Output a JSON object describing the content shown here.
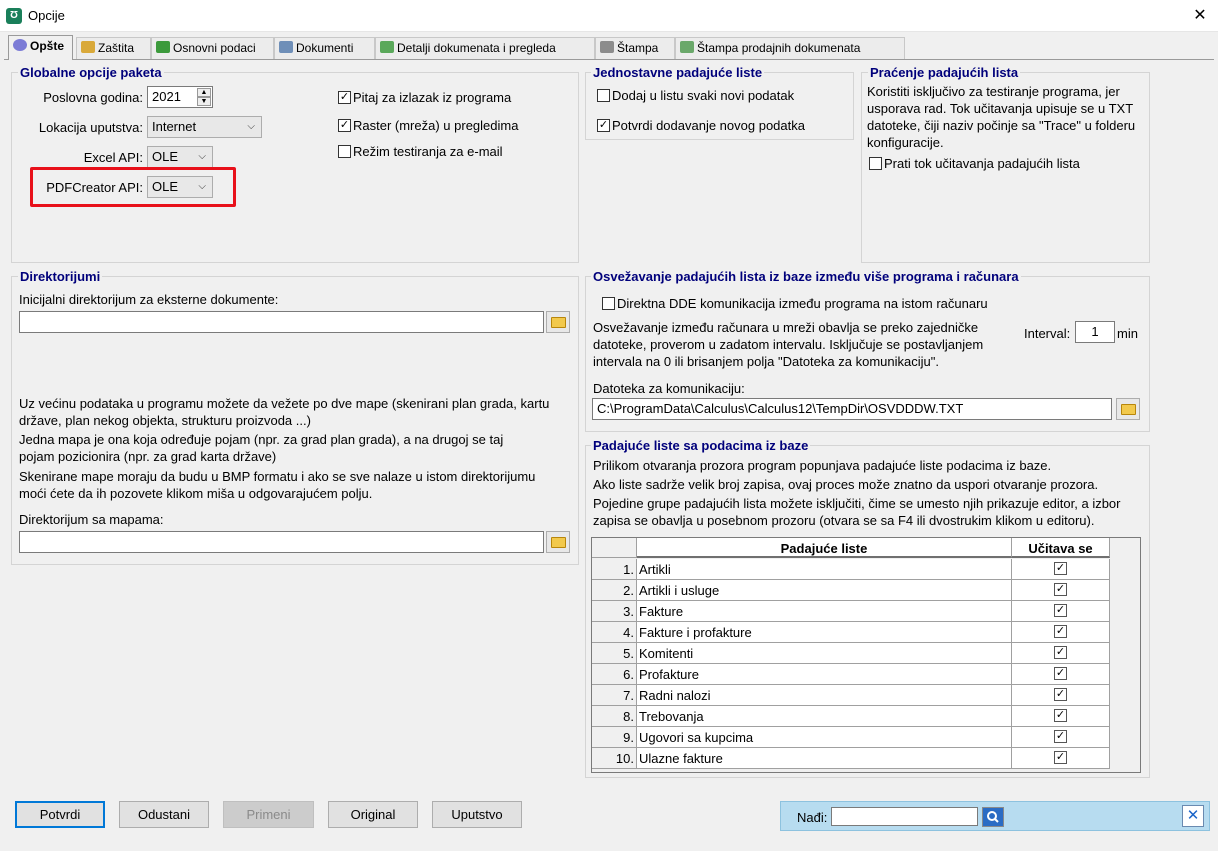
{
  "window": {
    "title": "Opcije",
    "app_icon": "app-logo-icon",
    "close_glyph": "✕"
  },
  "tabs": [
    {
      "label": "Opšte",
      "icon": "gear-icon",
      "active": true
    },
    {
      "label": "Zaštita",
      "icon": "lock-icon"
    },
    {
      "label": "Osnovni podaci",
      "icon": "database-icon"
    },
    {
      "label": "Dokumenti",
      "icon": "document-icon"
    },
    {
      "label": "Detalji dokumenata i pregleda",
      "icon": "document-detail-icon"
    },
    {
      "label": "Štampa",
      "icon": "printer-icon"
    },
    {
      "label": "Štampa prodajnih dokumenata",
      "icon": "printer-docs-icon"
    }
  ],
  "global": {
    "title": "Globalne opcije paketa",
    "year_label": "Poslovna godina:",
    "year_value": "2021",
    "manual_label": "Lokacija uputstva:",
    "manual_value": "Internet",
    "excel_label": "Excel API:",
    "excel_value": "OLE",
    "pdf_label": "PDFCreator API:",
    "pdf_value": "OLE",
    "checks": [
      {
        "label": "Pitaj za izlazak iz programa",
        "checked": true
      },
      {
        "label": "Raster (mreža) u pregledima",
        "checked": true
      },
      {
        "label": "Režim testiranja za e-mail",
        "checked": false
      }
    ]
  },
  "simple_lists": {
    "title": "Jednostavne padajuće liste",
    "checks": [
      {
        "label": "Dodaj u listu svaki novi podatak",
        "checked": false
      },
      {
        "label": "Potvrdi dodavanje novog podatka",
        "checked": true
      }
    ]
  },
  "tracking": {
    "title": "Praćenje padajućih lista",
    "lines": [
      "Koristiti isključivo za testiranje programa, jer",
      "usporava rad. Tok učitavanja upisuje se u TXT",
      "datoteke, čiji naziv počinje sa \"Trace\" u folderu",
      "konfiguracije."
    ],
    "check_label": "Prati tok učitavanja padajućih lista",
    "checked": false
  },
  "directories": {
    "title": "Direktorijumi",
    "initial_label": "Inicijalni direktorijum za eksterne dokumente:",
    "initial_value": "",
    "para1": [
      "Uz većinu podataka u programu možete da vežete po dve mape (skenirani plan grada, kartu",
      "države, plan nekog objekta, strukturu proizvoda ...)"
    ],
    "para2": [
      "Jedna mapa je ona koja određuje pojam (npr. za grad plan grada), a na drugoj se taj",
      "pojam pozicionira (npr. za grad karta države)"
    ],
    "para3": [
      "Skenirane mape moraju da budu u BMP formatu i ako se sve nalaze u istom direktorijumu",
      "moći ćete da ih pozovete klikom miša u odgovarajućem polju."
    ],
    "maps_label": "Direktorijum sa mapama:",
    "maps_value": ""
  },
  "refresh": {
    "title": "Osvežavanje padajućih lista iz baze između više programa i računara",
    "dde_label": "Direktna DDE komunikacija između programa na istom računaru",
    "dde_checked": false,
    "lines": [
      "Osvežavanje između računara u mreži obavlja se preko zajedničke",
      "datoteke, proverom u zadatom intervalu. Isključuje se postavljanjem",
      "intervala na 0 ili brisanjem polja \"Datoteka za komunikaciju\"."
    ],
    "interval_label": "Interval:",
    "interval_value": "1",
    "interval_unit": "min",
    "file_label": "Datoteka za komunikaciju:",
    "file_value": "C:\\ProgramData\\Calculus\\Calculus12\\TempDir\\OSVDDDW.TXT"
  },
  "db_lists": {
    "title": "Padajuće liste sa podacima iz baze",
    "lines": [
      "Prilikom otvaranja prozora program popunjava padajuće liste podacima iz baze.",
      "Ako liste sadrže velik broj zapisa, ovaj proces može znatno da uspori otvaranje prozora.",
      "Pojedine grupe padajućih lista možete isključiti, čime se umesto njih prikazuje editor, a izbor",
      "zapisa se obavlja u posebnom prozoru (otvara se sa F4 ili dvostrukim klikom u editoru)."
    ],
    "col_name": "Padajuće liste",
    "col_load": "Učitava se",
    "rows": [
      {
        "n": "1.",
        "name": "Artikli",
        "checked": true
      },
      {
        "n": "2.",
        "name": "Artikli i usluge",
        "checked": true
      },
      {
        "n": "3.",
        "name": "Fakture",
        "checked": true
      },
      {
        "n": "4.",
        "name": "Fakture i profakture",
        "checked": true
      },
      {
        "n": "5.",
        "name": "Komitenti",
        "checked": true
      },
      {
        "n": "6.",
        "name": "Profakture",
        "checked": true
      },
      {
        "n": "7.",
        "name": "Radni nalozi",
        "checked": true
      },
      {
        "n": "8.",
        "name": "Trebovanja",
        "checked": true
      },
      {
        "n": "9.",
        "name": "Ugovori sa kupcima",
        "checked": true
      },
      {
        "n": "10.",
        "name": "Ulazne fakture",
        "checked": true
      }
    ]
  },
  "buttons": {
    "confirm": "Potvrdi",
    "cancel": "Odustani",
    "apply": "Primeni",
    "original": "Original",
    "manual": "Uputstvo"
  },
  "find": {
    "label": "Nađi:",
    "value": ""
  },
  "colors": {
    "group_title": "#00007b",
    "highlight": "#e8101a",
    "find_bar": "#b7dcf0"
  }
}
